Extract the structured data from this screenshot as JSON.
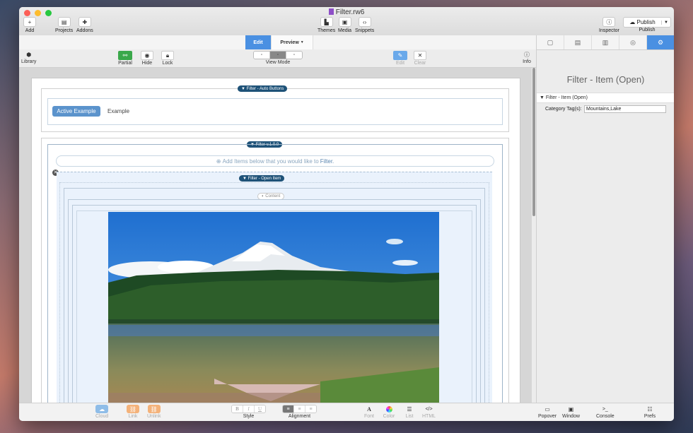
{
  "window": {
    "title": "Filter.rw6"
  },
  "toolbar": {
    "add": "Add",
    "projects": "Projects",
    "addons": "Addons",
    "themes": "Themes",
    "media": "Media",
    "snippets": "Snippets",
    "inspector": "Inspector",
    "publish_button": "Publish",
    "publish": "Publish"
  },
  "mode_tabs": {
    "edit": "Edit",
    "preview": "Preview"
  },
  "subtoolbar": {
    "library": "Library",
    "partial": "Partial",
    "hide": "Hide",
    "lock": "Lock",
    "view_mode": "View Mode",
    "edit": "Edit",
    "clear": "Clear",
    "info": "Info"
  },
  "canvas": {
    "filter_auto_buttons": "Filter - Auto Buttons",
    "active_example": "Active Example",
    "example": "Example",
    "filter_version": "Filter v.1.0.0",
    "add_items_text": "Add Items below that you would like to",
    "add_items_bold": "Filter.",
    "filter_open_item": "Filter - Open Item",
    "content": "Content"
  },
  "inspector": {
    "title": "Filter - Item (Open)",
    "section": "Filter - Item (Open)",
    "category_label": "Category Tag(s):",
    "category_value": "Mountains,Lake"
  },
  "bottom": {
    "cloud": "Cloud",
    "link": "Link",
    "unlink": "Unlink",
    "style": "Style",
    "alignment": "Alignment",
    "font": "Font",
    "color": "Color",
    "list": "List",
    "html": "HTML",
    "popover": "Popover",
    "window": "Window",
    "console": "Console",
    "prefs": "Prefs"
  },
  "colors": {
    "accent": "#4a90e2",
    "pill": "#1e5278",
    "active_button": "#5b93cc",
    "orange": "#f0a050"
  }
}
